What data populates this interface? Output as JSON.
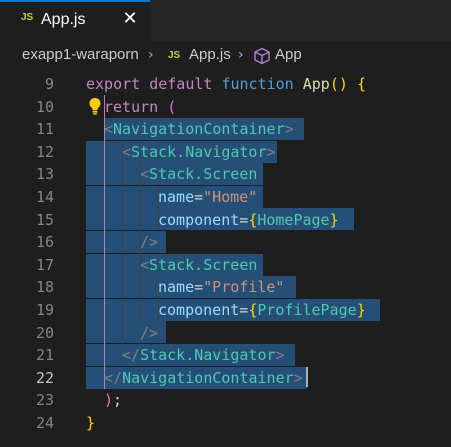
{
  "tab": {
    "icon": "JS",
    "filename": "App.js",
    "close": "✕"
  },
  "breadcrumb": {
    "folder": "exapp1-waraporn",
    "file_icon": "JS",
    "file": "App.js",
    "symbol": "App",
    "separator": "›"
  },
  "colors": {
    "accent": "#0078d4",
    "selection": "#264f78",
    "js_icon": "#cbcb41"
  },
  "lines": [
    {
      "no": "9",
      "current": false
    },
    {
      "no": "10",
      "current": false
    },
    {
      "no": "11",
      "current": false
    },
    {
      "no": "12",
      "current": false
    },
    {
      "no": "13",
      "current": false
    },
    {
      "no": "14",
      "current": false
    },
    {
      "no": "15",
      "current": false
    },
    {
      "no": "16",
      "current": false
    },
    {
      "no": "17",
      "current": false
    },
    {
      "no": "18",
      "current": false
    },
    {
      "no": "19",
      "current": false
    },
    {
      "no": "20",
      "current": false
    },
    {
      "no": "21",
      "current": false
    },
    {
      "no": "22",
      "current": true
    },
    {
      "no": "23",
      "current": false
    },
    {
      "no": "24",
      "current": false
    }
  ],
  "code": {
    "l9": {
      "kw1": "export",
      "kw2": "default",
      "kw3": "function",
      "name": "App",
      "p": "()",
      "brace": "{"
    },
    "l10": {
      "kw": "return",
      "paren": "("
    },
    "l11": {
      "open": "<",
      "tag": "NavigationContainer",
      "close": ">"
    },
    "l12": {
      "open": "<",
      "tag": "Stack.Navigator",
      "close": ">"
    },
    "l13": {
      "open": "<",
      "tag": "Stack.Screen"
    },
    "l14": {
      "attr": "name",
      "eq": "=",
      "val": "\"Home\""
    },
    "l15": {
      "attr": "component",
      "eq": "=",
      "lb": "{",
      "val": "HomePage",
      "rb": "}"
    },
    "l16": {
      "close": "/>"
    },
    "l17": {
      "open": "<",
      "tag": "Stack.Screen"
    },
    "l18": {
      "attr": "name",
      "eq": "=",
      "val": "\"Profile\""
    },
    "l19": {
      "attr": "component",
      "eq": "=",
      "lb": "{",
      "val": "ProfilePage",
      "rb": "}"
    },
    "l20": {
      "close": "/>"
    },
    "l21": {
      "open": "</",
      "tag": "Stack.Navigator",
      "close": ">"
    },
    "l22": {
      "open": "</",
      "tag": "NavigationContainer",
      "close": ">"
    },
    "l23": {
      "paren": ")",
      "semi": ";"
    },
    "l24": {
      "brace": "}"
    }
  }
}
